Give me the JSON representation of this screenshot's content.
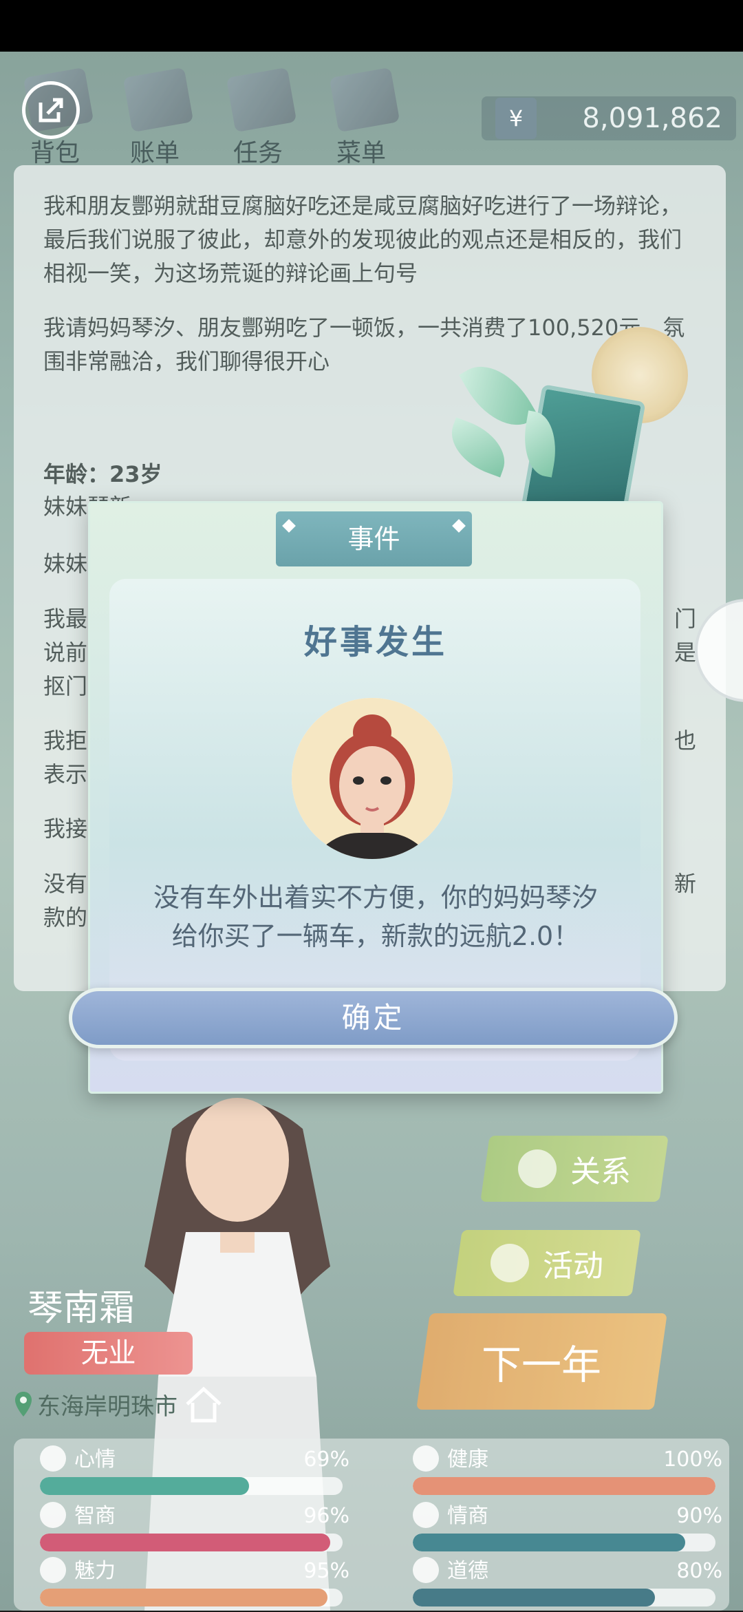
{
  "hud": {
    "buttons": [
      {
        "label": "背包",
        "icon": "backpack-icon"
      },
      {
        "label": "账单",
        "icon": "bill-icon"
      },
      {
        "label": "任务",
        "icon": "task-icon"
      },
      {
        "label": "菜单",
        "icon": "menu-icon"
      }
    ],
    "exit_icon": "exit-icon",
    "currency_symbol": "¥",
    "money": "8,091,862"
  },
  "log": {
    "paragraphs": [
      "我和朋友酆朔就甜豆腐脑好吃还是咸豆腐脑好吃进行了一场辩论，最后我们说服了彼此，却意外的发现彼此的观点还是相反的，我们相视一笑，为这场荒诞的辩论画上句号",
      "我请妈妈琴汐、朋友酆朔吃了一顿饭，一共消费了100,520元，氛围非常融洽，我们聊得很开心"
    ],
    "age_line": "年龄：23岁",
    "partial_lines": [
      "妹妹琴新",
      "妹妹",
      "我最",
      "说前",
      "抠门",
      "我拒",
      "表示",
      "我接",
      "没有",
      "款的"
    ],
    "partial_right": [
      "门",
      "是",
      "也",
      "新"
    ]
  },
  "side_buttons": [
    {
      "label": "关系",
      "icon": "relation-icon"
    },
    {
      "label": "活动",
      "icon": "activity-icon"
    },
    {
      "label": "下一年"
    }
  ],
  "character": {
    "name": "琴南霜",
    "job": "无业",
    "location": "东海岸明珠市"
  },
  "stats": [
    {
      "name": "心情",
      "value": "69%",
      "level": 69,
      "color": "#2f9a86",
      "icon": "smile-icon"
    },
    {
      "name": "健康",
      "value": "100%",
      "level": 100,
      "color": "#e07a58",
      "icon": "heart-icon"
    },
    {
      "name": "智商",
      "value": "96%",
      "level": 96,
      "color": "#c9395a",
      "icon": "bulb-icon"
    },
    {
      "name": "情商",
      "value": "90%",
      "level": 90,
      "color": "#1f6e7a",
      "icon": "apple-icon"
    },
    {
      "name": "魅力",
      "value": "95%",
      "level": 95,
      "color": "#e08a58",
      "icon": "sparkle-icon"
    },
    {
      "name": "道德",
      "value": "80%",
      "level": 80,
      "color": "#1f5f6e",
      "icon": "scale-icon"
    }
  ],
  "dialog": {
    "tab": "事件",
    "title": "好事发生",
    "message_line1": "没有车外出着实不方便，你的妈妈琴汐",
    "message_line2": "给你买了一辆车，新款的远航2.0！",
    "confirm": "确定",
    "avatar_icon": "mother-avatar"
  }
}
